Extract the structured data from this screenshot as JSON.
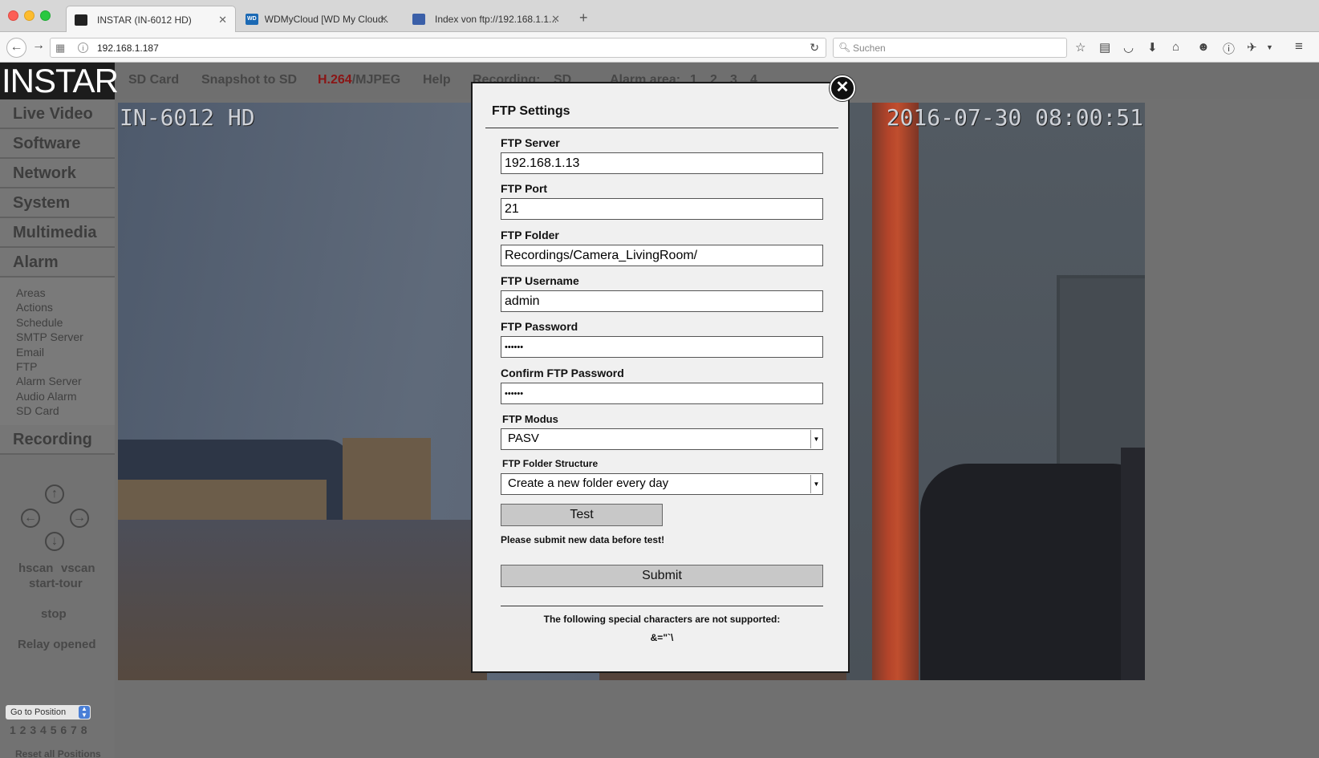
{
  "browser": {
    "tabs": [
      {
        "label": "INSTAR (IN-6012 HD)",
        "active": true
      },
      {
        "label": "WDMyCloud [WD My Cloud...",
        "active": false
      },
      {
        "label": "Index von ftp://192.168.1.1...",
        "active": false
      }
    ],
    "url": "192.168.1.187",
    "search_placeholder": "Suchen",
    "favicon_wd": "WD"
  },
  "logo": "INSTAR",
  "topnav": {
    "sd_card": "SD Card",
    "snapshot": "Snapshot to SD",
    "h264": "H.264",
    "mjpeg": "/MJPEG",
    "help": "Help",
    "recording_label": "Recording:",
    "recording_value": "SD",
    "alarm_label": "Alarm area:",
    "alarm_1": "1",
    "alarm_2": "2",
    "alarm_3": "3",
    "alarm_4": "4"
  },
  "sidebar": {
    "sections": {
      "live": "Live Video",
      "software": "Software",
      "network": "Network",
      "system": "System",
      "multimedia": "Multimedia",
      "alarm": "Alarm",
      "recording": "Recording"
    },
    "alarm_items": [
      "Areas",
      "Actions",
      "Schedule",
      "SMTP Server",
      "Email",
      "FTP",
      "Alarm Server",
      "Audio Alarm",
      "SD Card"
    ],
    "hscan": "hscan",
    "vscan": "vscan",
    "start_tour": "start-tour",
    "stop": "stop",
    "relay": "Relay opened",
    "goto_position": "Go to Position",
    "positions": "1 2 3 4 5 6 7 8",
    "reset_positions": "Reset all Positions"
  },
  "video": {
    "camera_name": "IN-6012 HD",
    "timestamp": "2016-07-30 08:00:51"
  },
  "modal": {
    "title": "FTP Settings",
    "server_label": "FTP Server",
    "server_value": "192.168.1.13",
    "port_label": "FTP Port",
    "port_value": "21",
    "folder_label": "FTP Folder",
    "folder_value": "Recordings/Camera_LivingRoom/",
    "username_label": "FTP Username",
    "username_value": "admin",
    "password_label": "FTP Password",
    "password_value": "••••••",
    "confirm_label": "Confirm FTP Password",
    "confirm_value": "••••••",
    "modus_label": "FTP Modus",
    "modus_value": "PASV",
    "structure_label": "FTP Folder Structure",
    "structure_value": "Create a new folder every day",
    "test_button": "Test",
    "note": "Please submit new data before test!",
    "submit_button": "Submit",
    "special_note": "The following special characters are not supported:",
    "special_chars": "&=\"`\\"
  }
}
